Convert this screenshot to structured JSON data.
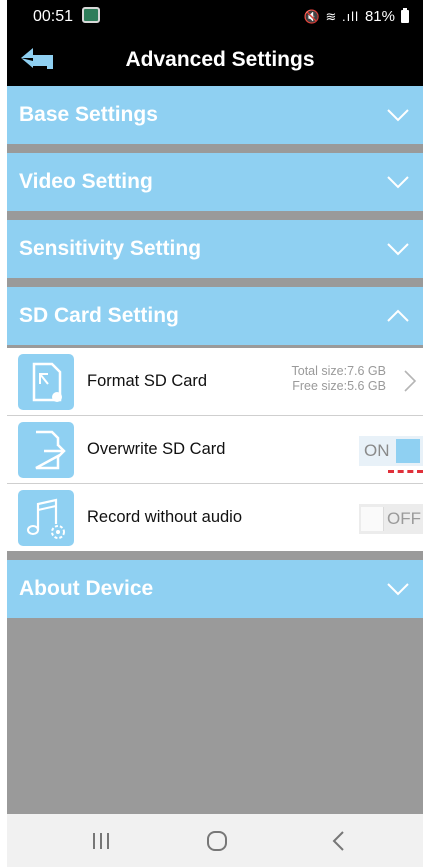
{
  "status_bar": {
    "time": "00:51",
    "signal_icons": "🔇 ≋ .ıll",
    "battery": "81%"
  },
  "header": {
    "title": "Advanced Settings",
    "back_icon": "back-arrow-icon"
  },
  "sections": {
    "base": {
      "label": "Base Settings",
      "expanded": false
    },
    "video": {
      "label": "Video Setting",
      "expanded": false
    },
    "sensitivity": {
      "label": "Sensitivity Setting",
      "expanded": false
    },
    "sd_card": {
      "label": "SD Card Setting",
      "expanded": true
    },
    "about": {
      "label": "About Device",
      "expanded": false
    }
  },
  "sd_card_rows": {
    "format": {
      "label": "Format SD Card",
      "total_size": "Total size:7.6 GB",
      "free_size": "Free size:5.6 GB",
      "icon": "sd-card-format-icon"
    },
    "overwrite": {
      "label": "Overwrite SD Card",
      "toggle_text": "ON",
      "state": true,
      "icon": "sd-card-overwrite-icon"
    },
    "record": {
      "label": "Record without audio",
      "toggle_text": "OFF",
      "state": false,
      "icon": "music-settings-icon"
    }
  },
  "colors": {
    "accent": "#8fd0f2",
    "header_bg": "#000000",
    "content_bg": "#9a9a9a"
  }
}
